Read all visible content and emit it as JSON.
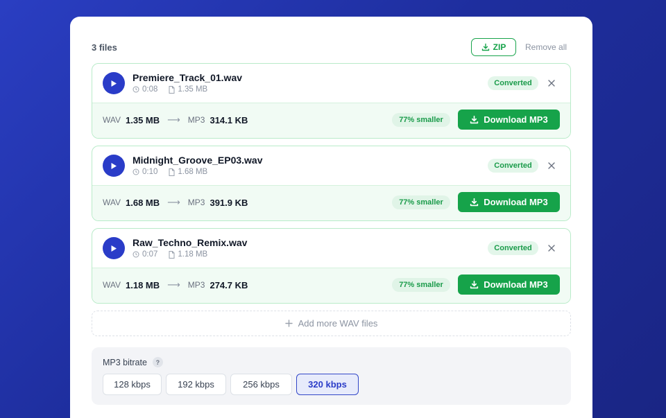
{
  "header": {
    "file_count": "3 files",
    "zip_label": "ZIP",
    "remove_all_label": "Remove all"
  },
  "files": [
    {
      "name": "Premiere_Track_01.wav",
      "duration": "0:08",
      "size": "1.35 MB",
      "status": "Converted",
      "from_format": "WAV",
      "from_size": "1.35 MB",
      "to_format": "MP3",
      "to_size": "314.1 KB",
      "reduction": "77% smaller",
      "download_label": "Download MP3"
    },
    {
      "name": "Midnight_Groove_EP03.wav",
      "duration": "0:10",
      "size": "1.68 MB",
      "status": "Converted",
      "from_format": "WAV",
      "from_size": "1.68 MB",
      "to_format": "MP3",
      "to_size": "391.9 KB",
      "reduction": "77% smaller",
      "download_label": "Download MP3"
    },
    {
      "name": "Raw_Techno_Remix.wav",
      "duration": "0:07",
      "size": "1.18 MB",
      "status": "Converted",
      "from_format": "WAV",
      "from_size": "1.18 MB",
      "to_format": "MP3",
      "to_size": "274.7 KB",
      "reduction": "77% smaller",
      "download_label": "Download MP3"
    }
  ],
  "add_more_label": "Add more WAV files",
  "bitrate": {
    "label": "MP3 bitrate",
    "help": "?",
    "options": [
      "128 kbps",
      "192 kbps",
      "256 kbps",
      "320 kbps"
    ],
    "selected": "320 kbps"
  },
  "colors": {
    "accent": "#2a3cc8",
    "success": "#16a34a",
    "background": "#1e2e9e"
  },
  "icons": {
    "zip": "download-icon",
    "play": "play-icon",
    "duration": "clock-icon",
    "size": "file-icon",
    "close": "close-icon",
    "download": "download-icon",
    "add": "plus-icon"
  }
}
